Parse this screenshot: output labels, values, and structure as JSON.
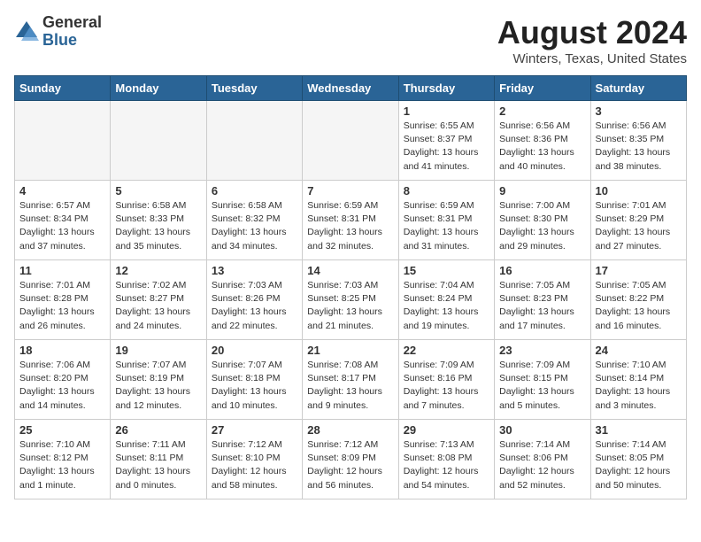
{
  "logo": {
    "general": "General",
    "blue": "Blue"
  },
  "title": "August 2024",
  "location": "Winters, Texas, United States",
  "weekdays": [
    "Sunday",
    "Monday",
    "Tuesday",
    "Wednesday",
    "Thursday",
    "Friday",
    "Saturday"
  ],
  "weeks": [
    [
      {
        "day": "",
        "info": ""
      },
      {
        "day": "",
        "info": ""
      },
      {
        "day": "",
        "info": ""
      },
      {
        "day": "",
        "info": ""
      },
      {
        "day": "1",
        "info": "Sunrise: 6:55 AM\nSunset: 8:37 PM\nDaylight: 13 hours\nand 41 minutes."
      },
      {
        "day": "2",
        "info": "Sunrise: 6:56 AM\nSunset: 8:36 PM\nDaylight: 13 hours\nand 40 minutes."
      },
      {
        "day": "3",
        "info": "Sunrise: 6:56 AM\nSunset: 8:35 PM\nDaylight: 13 hours\nand 38 minutes."
      }
    ],
    [
      {
        "day": "4",
        "info": "Sunrise: 6:57 AM\nSunset: 8:34 PM\nDaylight: 13 hours\nand 37 minutes."
      },
      {
        "day": "5",
        "info": "Sunrise: 6:58 AM\nSunset: 8:33 PM\nDaylight: 13 hours\nand 35 minutes."
      },
      {
        "day": "6",
        "info": "Sunrise: 6:58 AM\nSunset: 8:32 PM\nDaylight: 13 hours\nand 34 minutes."
      },
      {
        "day": "7",
        "info": "Sunrise: 6:59 AM\nSunset: 8:31 PM\nDaylight: 13 hours\nand 32 minutes."
      },
      {
        "day": "8",
        "info": "Sunrise: 6:59 AM\nSunset: 8:31 PM\nDaylight: 13 hours\nand 31 minutes."
      },
      {
        "day": "9",
        "info": "Sunrise: 7:00 AM\nSunset: 8:30 PM\nDaylight: 13 hours\nand 29 minutes."
      },
      {
        "day": "10",
        "info": "Sunrise: 7:01 AM\nSunset: 8:29 PM\nDaylight: 13 hours\nand 27 minutes."
      }
    ],
    [
      {
        "day": "11",
        "info": "Sunrise: 7:01 AM\nSunset: 8:28 PM\nDaylight: 13 hours\nand 26 minutes."
      },
      {
        "day": "12",
        "info": "Sunrise: 7:02 AM\nSunset: 8:27 PM\nDaylight: 13 hours\nand 24 minutes."
      },
      {
        "day": "13",
        "info": "Sunrise: 7:03 AM\nSunset: 8:26 PM\nDaylight: 13 hours\nand 22 minutes."
      },
      {
        "day": "14",
        "info": "Sunrise: 7:03 AM\nSunset: 8:25 PM\nDaylight: 13 hours\nand 21 minutes."
      },
      {
        "day": "15",
        "info": "Sunrise: 7:04 AM\nSunset: 8:24 PM\nDaylight: 13 hours\nand 19 minutes."
      },
      {
        "day": "16",
        "info": "Sunrise: 7:05 AM\nSunset: 8:23 PM\nDaylight: 13 hours\nand 17 minutes."
      },
      {
        "day": "17",
        "info": "Sunrise: 7:05 AM\nSunset: 8:22 PM\nDaylight: 13 hours\nand 16 minutes."
      }
    ],
    [
      {
        "day": "18",
        "info": "Sunrise: 7:06 AM\nSunset: 8:20 PM\nDaylight: 13 hours\nand 14 minutes."
      },
      {
        "day": "19",
        "info": "Sunrise: 7:07 AM\nSunset: 8:19 PM\nDaylight: 13 hours\nand 12 minutes."
      },
      {
        "day": "20",
        "info": "Sunrise: 7:07 AM\nSunset: 8:18 PM\nDaylight: 13 hours\nand 10 minutes."
      },
      {
        "day": "21",
        "info": "Sunrise: 7:08 AM\nSunset: 8:17 PM\nDaylight: 13 hours\nand 9 minutes."
      },
      {
        "day": "22",
        "info": "Sunrise: 7:09 AM\nSunset: 8:16 PM\nDaylight: 13 hours\nand 7 minutes."
      },
      {
        "day": "23",
        "info": "Sunrise: 7:09 AM\nSunset: 8:15 PM\nDaylight: 13 hours\nand 5 minutes."
      },
      {
        "day": "24",
        "info": "Sunrise: 7:10 AM\nSunset: 8:14 PM\nDaylight: 13 hours\nand 3 minutes."
      }
    ],
    [
      {
        "day": "25",
        "info": "Sunrise: 7:10 AM\nSunset: 8:12 PM\nDaylight: 13 hours\nand 1 minute."
      },
      {
        "day": "26",
        "info": "Sunrise: 7:11 AM\nSunset: 8:11 PM\nDaylight: 13 hours\nand 0 minutes."
      },
      {
        "day": "27",
        "info": "Sunrise: 7:12 AM\nSunset: 8:10 PM\nDaylight: 12 hours\nand 58 minutes."
      },
      {
        "day": "28",
        "info": "Sunrise: 7:12 AM\nSunset: 8:09 PM\nDaylight: 12 hours\nand 56 minutes."
      },
      {
        "day": "29",
        "info": "Sunrise: 7:13 AM\nSunset: 8:08 PM\nDaylight: 12 hours\nand 54 minutes."
      },
      {
        "day": "30",
        "info": "Sunrise: 7:14 AM\nSunset: 8:06 PM\nDaylight: 12 hours\nand 52 minutes."
      },
      {
        "day": "31",
        "info": "Sunrise: 7:14 AM\nSunset: 8:05 PM\nDaylight: 12 hours\nand 50 minutes."
      }
    ]
  ]
}
